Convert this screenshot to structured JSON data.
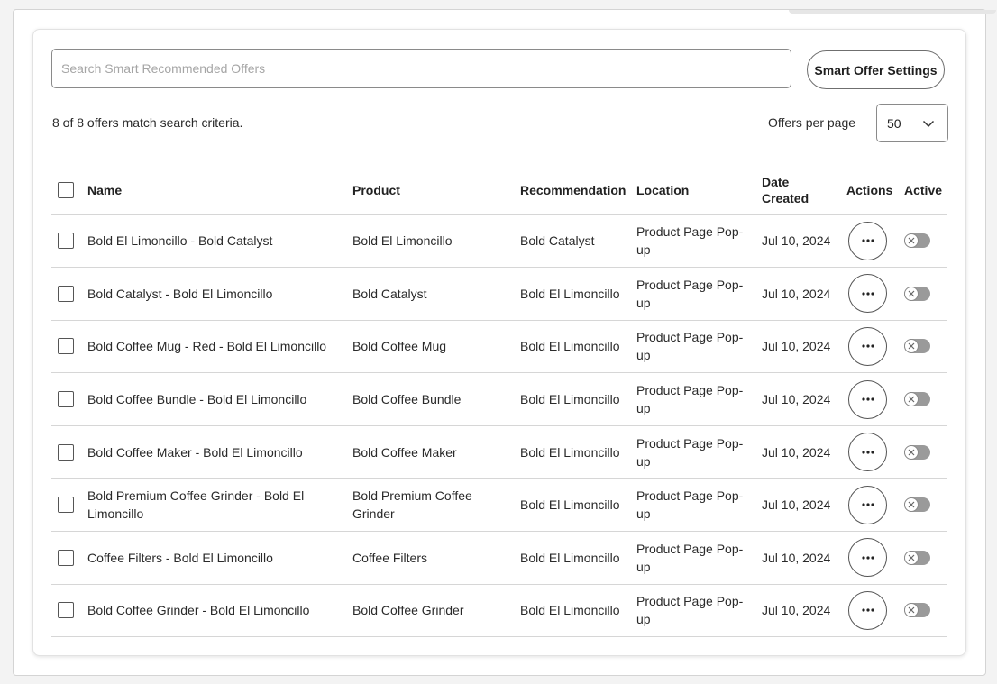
{
  "search": {
    "placeholder": "Search Smart Recommended Offers",
    "value": ""
  },
  "settings_button": "Smart Offer Settings",
  "match_text": "8 of 8 offers match search criteria.",
  "per_page": {
    "label": "Offers per page",
    "value": "50"
  },
  "table": {
    "headers": {
      "name": "Name",
      "product": "Product",
      "recommendation": "Recommendation",
      "location": "Location",
      "date_created": "Date Created",
      "actions": "Actions",
      "active": "Active"
    },
    "rows": [
      {
        "name": "Bold El Limoncillo - Bold Catalyst",
        "product": "Bold El Limoncillo",
        "recommendation": "Bold Catalyst",
        "location": "Product Page Pop-up",
        "date": "Jul 10, 2024",
        "active": false
      },
      {
        "name": "Bold Catalyst - Bold El Limoncillo",
        "product": "Bold Catalyst",
        "recommendation": "Bold El Limoncillo",
        "location": "Product Page Pop-up",
        "date": "Jul 10, 2024",
        "active": false
      },
      {
        "name": "Bold Coffee Mug - Red - Bold El Limoncillo",
        "product": "Bold Coffee Mug",
        "recommendation": "Bold El Limoncillo",
        "location": "Product Page Pop-up",
        "date": "Jul 10, 2024",
        "active": false
      },
      {
        "name": "Bold Coffee Bundle - Bold El Limoncillo",
        "product": "Bold Coffee Bundle",
        "recommendation": "Bold El Limoncillo",
        "location": "Product Page Pop-up",
        "date": "Jul 10, 2024",
        "active": false
      },
      {
        "name": "Bold Coffee Maker - Bold El Limoncillo",
        "product": "Bold Coffee Maker",
        "recommendation": "Bold El Limoncillo",
        "location": "Product Page Pop-up",
        "date": "Jul 10, 2024",
        "active": false
      },
      {
        "name": "Bold Premium Coffee Grinder - Bold El Limoncillo",
        "product": "Bold Premium Coffee Grinder",
        "recommendation": "Bold El Limoncillo",
        "location": "Product Page Pop-up",
        "date": "Jul 10, 2024",
        "active": false
      },
      {
        "name": "Coffee Filters - Bold El Limoncillo",
        "product": "Coffee Filters",
        "recommendation": "Bold El Limoncillo",
        "location": "Product Page Pop-up",
        "date": "Jul 10, 2024",
        "active": false
      },
      {
        "name": "Bold Coffee Grinder - Bold El Limoncillo",
        "product": "Bold Coffee Grinder",
        "recommendation": "Bold El Limoncillo",
        "location": "Product Page Pop-up",
        "date": "Jul 10, 2024",
        "active": false
      }
    ]
  },
  "icons": {
    "actions": "more-horizontal-icon",
    "toggle_off": "x-icon",
    "select": "chevron-down-icon"
  },
  "colors": {
    "toggle_off_track": "#9a9a9a",
    "border": "#8a8a8a",
    "placeholder": "#a5a5a5"
  }
}
